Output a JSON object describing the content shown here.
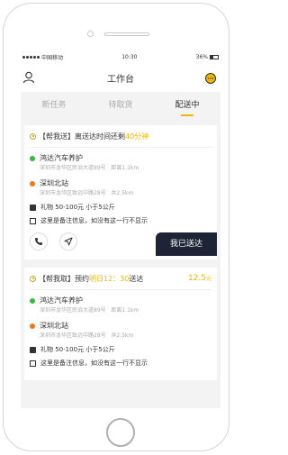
{
  "status_bar": {
    "carrier": "中国移动",
    "time": "10:30",
    "battery": "36%"
  },
  "navbar": {
    "title": "工作台"
  },
  "tabs": [
    {
      "label": "新任务"
    },
    {
      "label": "待取货"
    },
    {
      "label": "配送中",
      "active": true
    }
  ],
  "orders": [
    {
      "head_prefix": "【帮我送】离送达时间还剩",
      "head_highlight": "40分钟",
      "pickup": {
        "name": "鸿达汽车养护",
        "address": "深圳市龙华区民治大道89号",
        "distance": "距离1.1km"
      },
      "dropoff": {
        "name": "深圳北站",
        "address": "深圳市龙华区致远中路28号",
        "distance": "共2.5km"
      },
      "goods": "礼物  50-100元  小于5公斤",
      "note": "这里是备注信息，如没有这一行不显示",
      "action_label": "我已送达"
    },
    {
      "head_prefix": "【帮我取】预约",
      "head_highlight": "明日12：30",
      "head_suffix": "送达",
      "price": "12.5",
      "price_unit": "元",
      "pickup": {
        "name": "鸿达汽车养护",
        "address": "深圳市龙华区民治大道89号",
        "distance": "距离1.1km"
      },
      "dropoff": {
        "name": "深圳北站",
        "address": "深圳市龙华区致远中路28号",
        "distance": "共2.5km"
      },
      "goods": "礼物  50-100元  小于5公斤",
      "note": "这里是备注信息，如没有这一行不显示"
    }
  ],
  "colors": {
    "accent": "#f3b600",
    "pickup_dot": "#2fbe3a",
    "dropoff_dot": "#f07a1a",
    "button_dark": "#1d2435"
  }
}
